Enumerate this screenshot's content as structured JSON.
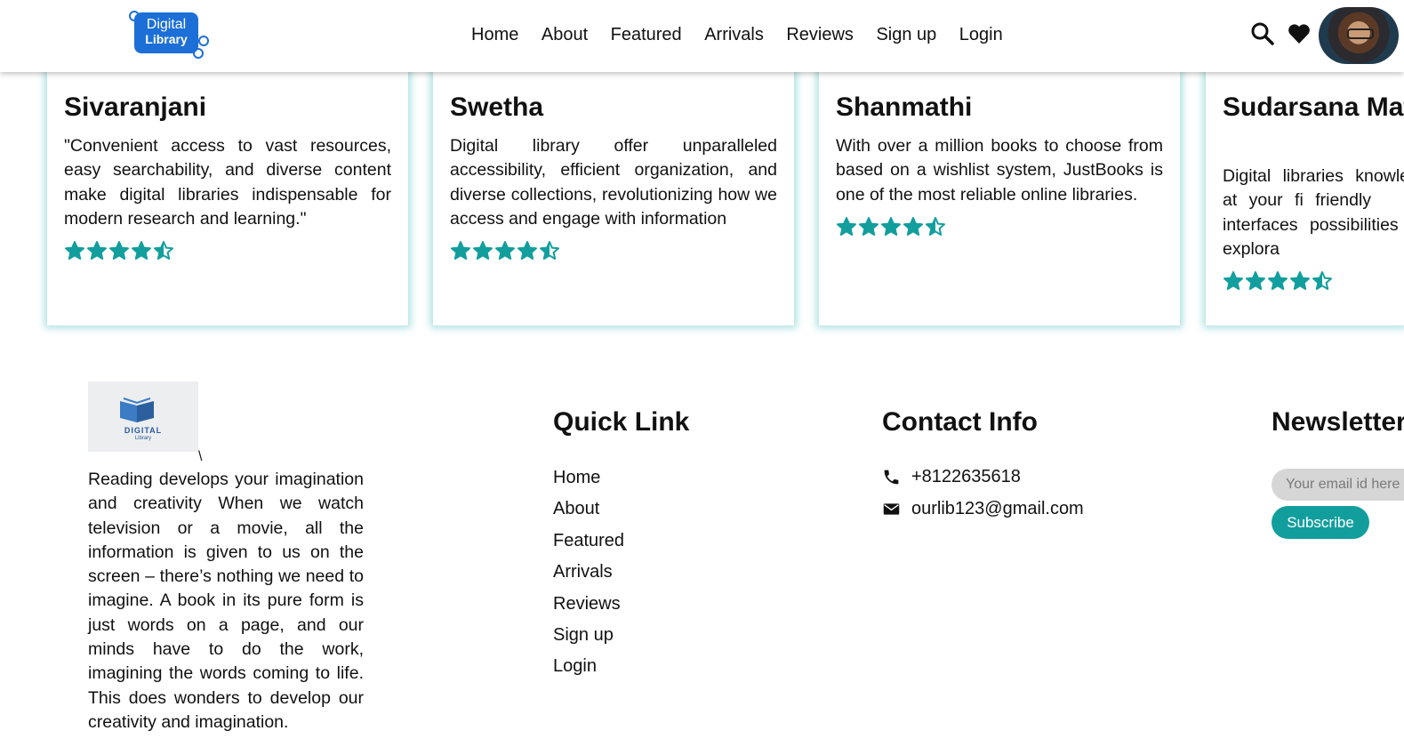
{
  "header": {
    "logo_line1": "Digital",
    "logo_line2": "Library",
    "nav": [
      "Home",
      "About",
      "Featured",
      "Arrivals",
      "Reviews",
      "Sign up",
      "Login"
    ],
    "icons": [
      "search-icon",
      "heart-icon",
      "avatar"
    ]
  },
  "reviews": [
    {
      "name": "Sivaranjani",
      "text": "\"Convenient access to vast resources, easy searchability, and diverse content make digital libraries indispensable for modern research and learning.\"",
      "rating": 4.5
    },
    {
      "name": "Swetha",
      "text": "Digital library offer unparalleled accessibility, efficient organization, and diverse collections, revolutionizing how we access and engage with information",
      "rating": 4.5
    },
    {
      "name": "Shanmathi",
      "text": "With over a million books to choose from based on a wishlist system, JustBooks is one of the most reliable online libraries.",
      "rating": 4.5
    },
    {
      "name": "Sudarsana Mathan",
      "text": "Digital libraries knowledge at your fi friendly interfaces possibilities for explora",
      "rating": 4.5
    }
  ],
  "footer": {
    "logo_caption": "DIGITAL",
    "logo_caption2": "Library",
    "backslash": "\\",
    "about": "Reading develops your imagination and creativity When we watch television or a movie, all the information is given to us on the screen – there’s nothing we need to imagine. A book in its pure form is just words on a page, and our minds have to do the work, imagining the words coming to life. This does wonders to develop our creativity and imagination.",
    "quick_link_title": "Quick Link",
    "quick_links": [
      "Home",
      "About",
      "Featured",
      "Arrivals",
      "Reviews",
      "Sign up",
      "Login"
    ],
    "contact_title": "Contact Info",
    "phone": "+8122635618",
    "email": "ourlib123@gmail.com",
    "newsletter_title": "Newsletter",
    "email_placeholder": "Your email id here",
    "subscribe_label": "Subscribe"
  },
  "colors": {
    "accent": "#139e9e",
    "logo_blue": "#1c6fd6",
    "star": "#139e9e"
  }
}
